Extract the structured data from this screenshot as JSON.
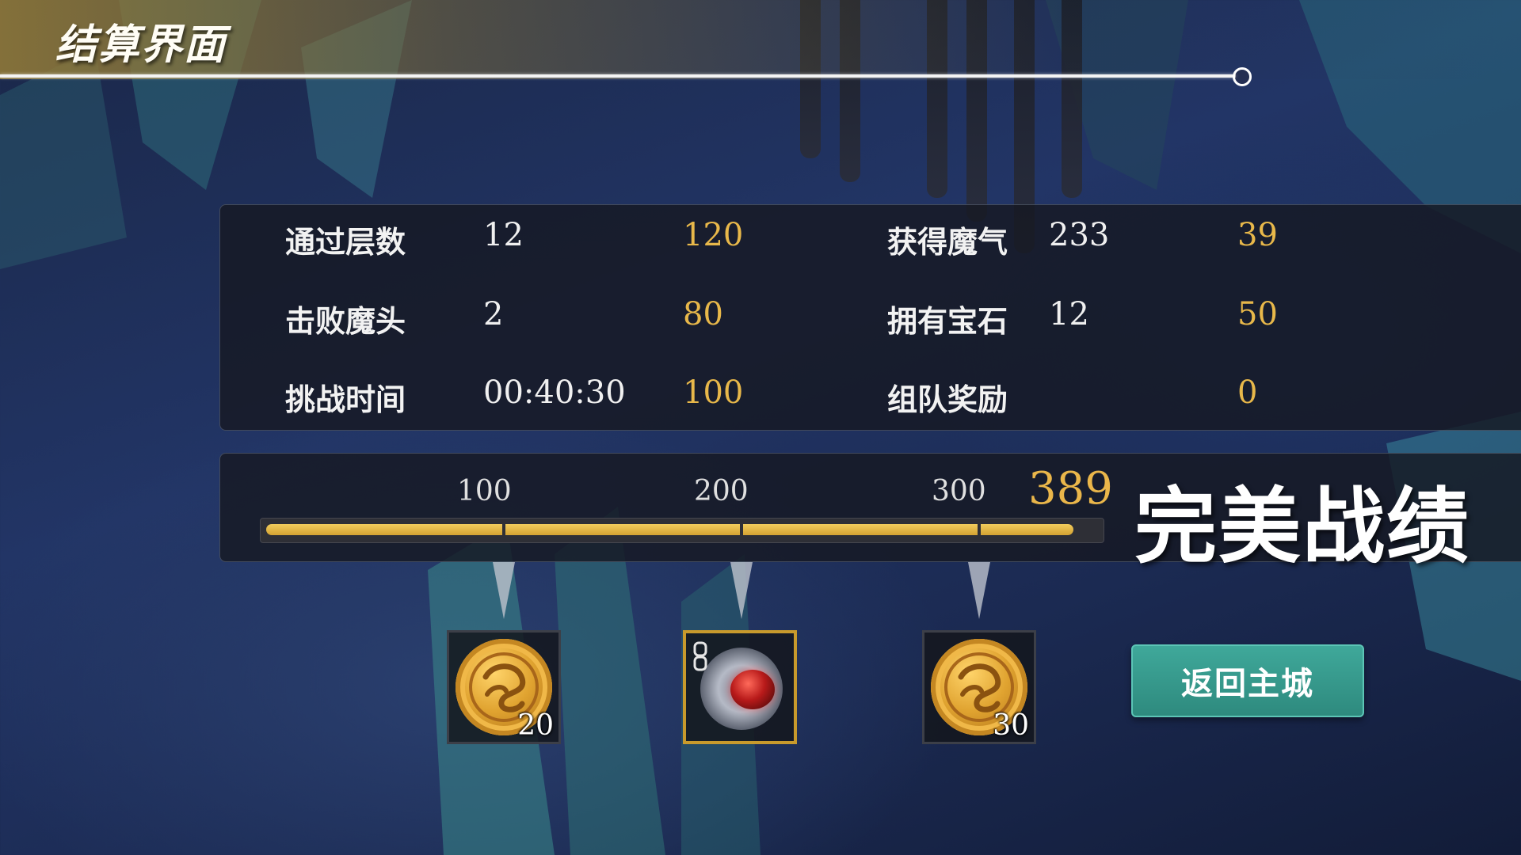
{
  "header": {
    "title": "结算界面"
  },
  "stats": {
    "left": [
      {
        "label": "通过层数",
        "value": "12",
        "score": "120"
      },
      {
        "label": "击败魔头",
        "value": "2",
        "score": "80"
      },
      {
        "label": "挑战时间",
        "value": "00:40:30",
        "score": "100"
      }
    ],
    "right": [
      {
        "label": "获得魔气",
        "value": "233",
        "score": "39"
      },
      {
        "label": "拥有宝石",
        "value": "12",
        "score": "50"
      },
      {
        "label": "组队奖励",
        "value": "",
        "score": "0"
      }
    ]
  },
  "progress": {
    "ticks": [
      "100",
      "200",
      "300"
    ],
    "total": "389",
    "max": 400,
    "current": 389,
    "rating": "完美战绩"
  },
  "rewards": [
    {
      "icon": "gold-coin-icon",
      "count": "20"
    },
    {
      "icon": "red-gem-orb-icon",
      "count": ""
    },
    {
      "icon": "gold-coin-icon",
      "count": "30"
    }
  ],
  "actions": {
    "return_label": "返回主城"
  },
  "colors": {
    "score": "#e8b84a",
    "bar": "#e8b84a",
    "button": "#3aa091"
  }
}
